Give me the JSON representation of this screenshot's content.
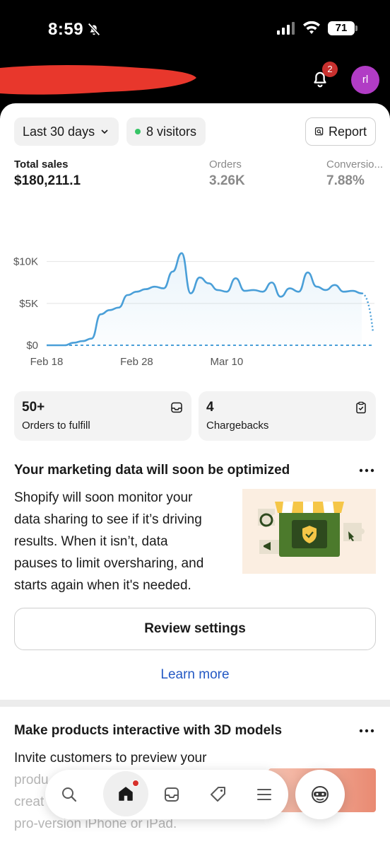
{
  "status_bar": {
    "time": "8:59",
    "battery": "71"
  },
  "header": {
    "notification_count": "2",
    "avatar_initials": "rl"
  },
  "filters": {
    "date_range": "Last 30 days",
    "visitors": "8 visitors",
    "report_label": "Report"
  },
  "metrics": [
    {
      "label": "Total sales",
      "value": "$180,211.1"
    },
    {
      "label": "Orders",
      "value": "3.26K"
    },
    {
      "label": "Conversio...",
      "value": "7.88%"
    }
  ],
  "chart_data": {
    "type": "line",
    "y_ticks": [
      "$10K",
      "$5K",
      "$0"
    ],
    "x_ticks": [
      "Feb 18",
      "Feb 28",
      "Mar 10"
    ],
    "ylim": [
      0,
      12000
    ],
    "series": [
      {
        "style": "solid",
        "values": [
          0,
          0,
          0,
          300,
          500,
          800,
          3700,
          4200,
          4500,
          6000,
          6400,
          6700,
          7000,
          6800,
          8800,
          11000,
          6200,
          8100,
          7400,
          6600,
          6400,
          8000,
          6500,
          6600,
          6400,
          7500,
          5800,
          6800,
          6400,
          8700,
          7000,
          6600,
          7200,
          6400,
          6500,
          6200
        ]
      },
      {
        "style": "dotted",
        "values": [
          6200,
          1500
        ]
      },
      {
        "style": "dashed",
        "values": [
          0,
          0
        ]
      }
    ],
    "grid": true
  },
  "stats": [
    {
      "value": "50+",
      "label": "Orders to fulfill"
    },
    {
      "value": "4",
      "label": "Chargebacks"
    }
  ],
  "marketing": {
    "title": "Your marketing data will soon be optimized",
    "lines": [
      "Shopify will soon monitor your",
      "data sharing to see if it’s driving",
      "results. When it isn’t, data",
      "pauses to limit oversharing, and",
      "starts again when it's needed."
    ],
    "button": "Review settings",
    "link": "Learn more"
  },
  "models": {
    "title": "Make products interactive with 3D models",
    "lines": [
      "Invite customers to preview your",
      "produ",
      "creat",
      "pro-version iPhone or iPad."
    ]
  },
  "colors": {
    "accent": "#4a9fd8",
    "link": "#2459c4",
    "badge": "#c8302e",
    "avatar": "#b13cc5"
  }
}
